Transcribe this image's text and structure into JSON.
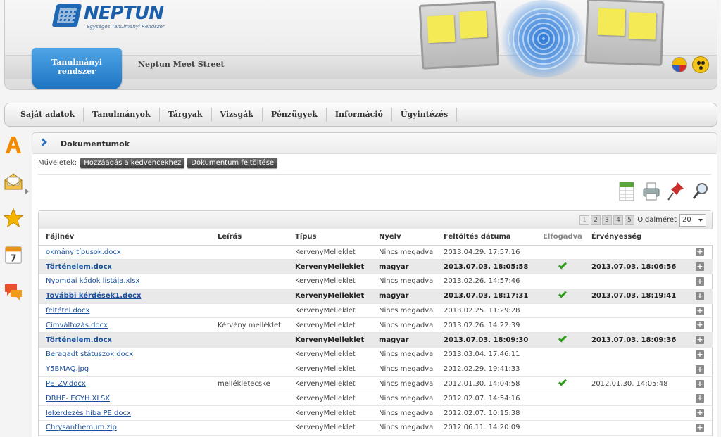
{
  "header": {
    "logo_text": "NEPTUN",
    "logo_subtitle": "Egységes Tanulmányi Rendszer",
    "tabs": [
      {
        "label": "Tanulmányi rendszer",
        "active": true
      },
      {
        "label": "Neptun Meet Street",
        "active": false
      }
    ]
  },
  "nav": {
    "items": [
      {
        "label": "Saját adatok"
      },
      {
        "label": "Tanulmányok"
      },
      {
        "label": "Tárgyak"
      },
      {
        "label": "Vizsgák"
      },
      {
        "label": "Pénzügyek"
      },
      {
        "label": "Információ"
      },
      {
        "label": "Ügyintézés"
      }
    ]
  },
  "panel": {
    "title": "Dokumentumok",
    "actions_label": "Műveletek:",
    "actions": [
      {
        "label": "Hozzáadás a kedvencekhez"
      },
      {
        "label": "Dokumentum feltöltése"
      }
    ],
    "tools": [
      "excel-export-icon",
      "print-icon",
      "pin-icon",
      "search-icon"
    ]
  },
  "pager": {
    "pages": [
      "1",
      "2",
      "3",
      "4",
      "5"
    ],
    "current": "1",
    "page_size_label": "Oldalméret",
    "page_size": "20"
  },
  "table": {
    "columns": [
      "Fájlnév",
      "Leírás",
      "Típus",
      "Nyelv",
      "Feltöltés dátuma",
      "Elfogadva",
      "Érvényesség"
    ],
    "rows": [
      {
        "file": "okmány típusok.docx",
        "desc": "",
        "type": "KervenyMelleklet",
        "lang": "Nincs megadva",
        "date": "2013.04.29. 17:57:16",
        "accepted": false,
        "valid": "",
        "highlight": false
      },
      {
        "file": "Történelem.docx",
        "desc": "",
        "type": "KervenyMelleklet",
        "lang": "magyar",
        "date": "2013.07.03. 18:05:58",
        "accepted": true,
        "valid": "2013.07.03. 18:06:56",
        "highlight": true
      },
      {
        "file": "Nyomdai kódok listája.xlsx",
        "desc": "",
        "type": "KervenyMelleklet",
        "lang": "Nincs megadva",
        "date": "2013.02.26. 14:57:46",
        "accepted": false,
        "valid": "",
        "highlight": false
      },
      {
        "file": "További kérdések1.docx",
        "desc": "",
        "type": "KervenyMelleklet",
        "lang": "magyar",
        "date": "2013.07.03. 18:17:31",
        "accepted": true,
        "valid": "2013.07.03. 18:19:41",
        "highlight": true
      },
      {
        "file": "feltétel.docx",
        "desc": "",
        "type": "KervenyMelleklet",
        "lang": "Nincs megadva",
        "date": "2013.02.25. 11:29:28",
        "accepted": false,
        "valid": "",
        "highlight": false
      },
      {
        "file": "Címváltozás.docx",
        "desc": "Kérvény melléklet",
        "type": "KervenyMelleklet",
        "lang": "Nincs megadva",
        "date": "2013.02.26. 14:22:39",
        "accepted": false,
        "valid": "",
        "highlight": false
      },
      {
        "file": "Történelem.docx",
        "desc": "",
        "type": "KervenyMelleklet",
        "lang": "magyar",
        "date": "2013.07.03. 18:09:30",
        "accepted": true,
        "valid": "2013.07.03. 18:09:36",
        "highlight": true
      },
      {
        "file": "Beragadt státuszok.docx",
        "desc": "",
        "type": "KervenyMelleklet",
        "lang": "Nincs megadva",
        "date": "2013.03.04. 17:46:11",
        "accepted": false,
        "valid": "",
        "highlight": false
      },
      {
        "file": "Y5BMAQ.jpg",
        "desc": "",
        "type": "KervenyMelleklet",
        "lang": "Nincs megadva",
        "date": "2012.02.29. 19:41:33",
        "accepted": false,
        "valid": "",
        "highlight": false
      },
      {
        "file": "PE_ZV.docx",
        "desc": "mellékletecske",
        "type": "KervenyMelleklet",
        "lang": "Nincs megadva",
        "date": "2012.01.30. 14:04:58",
        "accepted": true,
        "valid": "2012.01.30. 14:05:48",
        "highlight": false
      },
      {
        "file": "DRHE- EGYH.XLSX",
        "desc": "",
        "type": "KervenyMelleklet",
        "lang": "Nincs megadva",
        "date": "2012.02.07. 14:54:16",
        "accepted": false,
        "valid": "",
        "highlight": false
      },
      {
        "file": "lekérdezés hiba PE.docx",
        "desc": "",
        "type": "KervenyMelleklet",
        "lang": "Nincs megadva",
        "date": "2012.02.07. 10:15:38",
        "accepted": false,
        "valid": "",
        "highlight": false
      },
      {
        "file": "Chrysanthemum.zip",
        "desc": "",
        "type": "KervenyMelleklet",
        "lang": "Nincs megadva",
        "date": "2012.06.11. 14:20:09",
        "accepted": false,
        "valid": "",
        "highlight": false
      }
    ]
  },
  "sidebar": {
    "icons": [
      "text-size-icon",
      "envelope-icon",
      "star-icon",
      "calendar-icon",
      "chat-bubbles-icon"
    ],
    "calendar_day": "7"
  },
  "colors": {
    "accent": "#1a6fbf",
    "check": "#2e9a1a",
    "link": "#1b4f9c"
  }
}
